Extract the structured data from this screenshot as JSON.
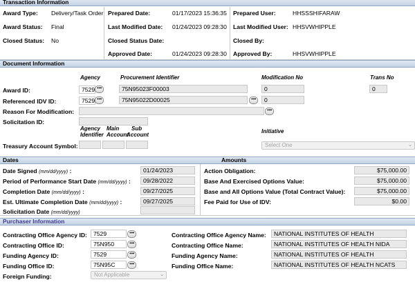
{
  "transaction": {
    "title": "Transaction Information",
    "award_type_label": "Award Type:",
    "award_type": "Delivery/Task Order",
    "award_status_label": "Award Status:",
    "award_status": "Final",
    "closed_status_label": "Closed Status:",
    "closed_status": "No",
    "prepared_date_label": "Prepared Date:",
    "prepared_date": "01/17/2023 15:36:35",
    "last_modified_date_label": "Last Modified Date:",
    "last_modified_date": "01/24/2023 09:28:30",
    "closed_status_date_label": "Closed Status Date:",
    "approved_date_label": "Approved Date:",
    "approved_date": "01/24/2023 09:28:30",
    "prepared_user_label": "Prepared User:",
    "prepared_user": "HHSSSHIFARAW",
    "last_modified_user_label": "Last Modified User:",
    "last_modified_user": "HHSVWHIPPLE",
    "closed_by_label": "Closed By:",
    "approved_by_label": "Approved By:",
    "approved_by": "HHSVWHIPPLE"
  },
  "document": {
    "title": "Document Information",
    "col_agency": "Agency",
    "col_procurement": "Procurement Identifier",
    "col_modification": "Modification No",
    "col_trans": "Trans No",
    "award_id_label": "Award ID:",
    "award_agency": "7529",
    "award_procurement": "75N95023F00003",
    "award_modification": "0",
    "award_trans": "0",
    "ref_idv_label": "Referenced IDV ID:",
    "ref_agency": "7529",
    "ref_procurement": "75N95022D00025",
    "ref_modification": "0",
    "reason_label": "Reason For Modification:",
    "solicitation_label": "Solicitation ID:",
    "col_agency_identifier_1": "Agency",
    "col_agency_identifier_2": "Identifier",
    "col_main_account_1": "Main",
    "col_main_account_2": "Account",
    "col_sub_account_1": "Sub",
    "col_sub_account_2": "Account",
    "col_initiative": "Initiative",
    "treasury_label": "Treasury Account Symbol:",
    "initiative_placeholder": "Select One"
  },
  "dates": {
    "title": "Dates",
    "date_signed_label": "Date Signed",
    "date_signed_fmt": "(mm/dd/yyyy)",
    "date_signed": "01/24/2023",
    "pop_start_label": "Period of Performance Start Date",
    "pop_start_fmt": "(mm/dd/yyyy)",
    "pop_start": "09/28/2022",
    "completion_label": "Completion Date",
    "completion_fmt": "(mm/dd/yyyy)",
    "completion": "09/27/2025",
    "est_ultimate_label": "Est. Ultimate Completion Date",
    "est_ultimate_fmt": "(mm/dd/yyyy)",
    "est_ultimate": "09/27/2025",
    "solicitation_date_label": "Solicitation Date",
    "solicitation_date_fmt": "(mm/dd/yyyy)",
    "colon": ":"
  },
  "amounts": {
    "title": "Amounts",
    "action_obligation_label": "Action Obligation:",
    "action_obligation": "$75,000.00",
    "base_exercised_label": "Base And Exercised Options Value:",
    "base_exercised": "$75,000.00",
    "base_all_label": "Base and All Options Value (Total Contract Value):",
    "base_all": "$75,000.00",
    "fee_paid_label": "Fee Paid for Use of IDV:",
    "fee_paid": "$0.00"
  },
  "purchaser": {
    "title": "Purchaser Information",
    "contracting_agency_id_label": "Contracting Office Agency ID:",
    "contracting_agency_id": "7529",
    "contracting_office_id_label": "Contracting Office ID:",
    "contracting_office_id": "75N950",
    "funding_agency_id_label": "Funding Agency ID:",
    "funding_agency_id": "7529",
    "funding_office_id_label": "Funding Office ID:",
    "funding_office_id": "75N95C",
    "foreign_funding_label": "Foreign Funding:",
    "foreign_funding_value": "Not Applicable",
    "contracting_agency_name_label": "Contracting Office Agency Name:",
    "contracting_agency_name": "NATIONAL INSTITUTES OF HEALTH",
    "contracting_office_name_label": "Contracting Office Name:",
    "contracting_office_name": "NATIONAL INSTITUTES OF HEALTH NIDA",
    "funding_agency_name_label": "Funding Agency Name:",
    "funding_agency_name": "NATIONAL INSTITUTES OF HEALTH",
    "funding_office_name_label": "Funding Office Name:",
    "funding_office_name": "NATIONAL INSTITUTES OF HEALTH NCATS"
  },
  "lookup_button_label": "•••",
  "select_chevron": "⌄"
}
